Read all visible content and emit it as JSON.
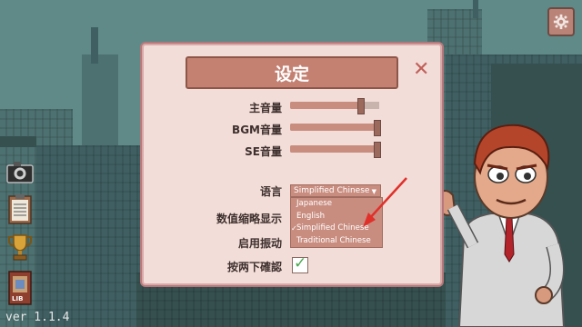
{
  "app": {
    "version": "ver 1.1.4"
  },
  "header": {
    "settings_icon": "gear-icon"
  },
  "sidebar": {
    "items": [
      {
        "icon": "camera-icon"
      },
      {
        "icon": "clipboard-icon"
      },
      {
        "icon": "trophy-icon"
      },
      {
        "icon": "book-icon",
        "label": "LIB"
      }
    ]
  },
  "dialog": {
    "title": "设定",
    "close_icon": "close-icon",
    "master_volume": {
      "label": "主音量",
      "level": 0.8
    },
    "bgm_volume": {
      "label": "BGM音量",
      "level": 1.0
    },
    "se_volume": {
      "label": "SE音量",
      "level": 1.0
    },
    "language": {
      "label": "语言",
      "selected": "Simplified Chinese",
      "options": [
        "Japanese",
        "English",
        "Simplified Chinese",
        "Traditional Chinese"
      ],
      "checked_option": "Simplified Chinese"
    },
    "number_abbrev": {
      "label": "数值缩略显示"
    },
    "vibration": {
      "label": "启用振动"
    },
    "confirm_on_press": {
      "label": "按两下確認",
      "checked": true
    }
  },
  "colors": {
    "dialog_bg": "#f3ddd8",
    "title_bg": "#c48172",
    "accent": "#c98d80",
    "arrow": "#e0302a"
  }
}
